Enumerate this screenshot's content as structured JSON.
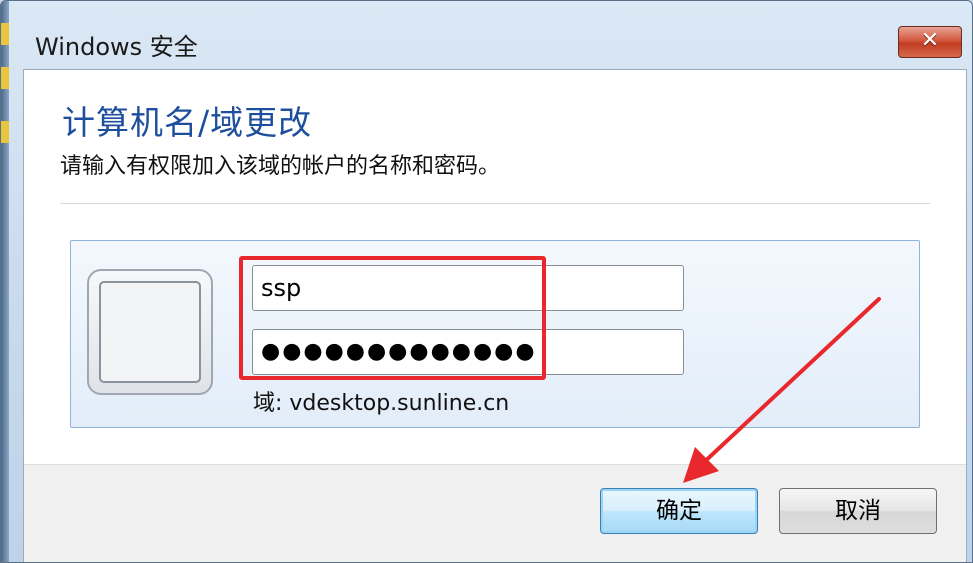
{
  "window": {
    "title": "Windows 安全",
    "close_label": "✕"
  },
  "dialog": {
    "heading": "计算机名/域更改",
    "instruction": "请输入有权限加入该域的帐户的名称和密码。"
  },
  "credentials": {
    "username_value": "ssp",
    "password_mask": "●●●●●●●●●●●●●",
    "domain_text": "域: vdesktop.sunline.cn"
  },
  "buttons": {
    "ok_label": "确定",
    "cancel_label": "取消"
  },
  "colors": {
    "heading": "#1e4f9c",
    "annotation": "#e8282c",
    "close_button": "#c13d22"
  }
}
